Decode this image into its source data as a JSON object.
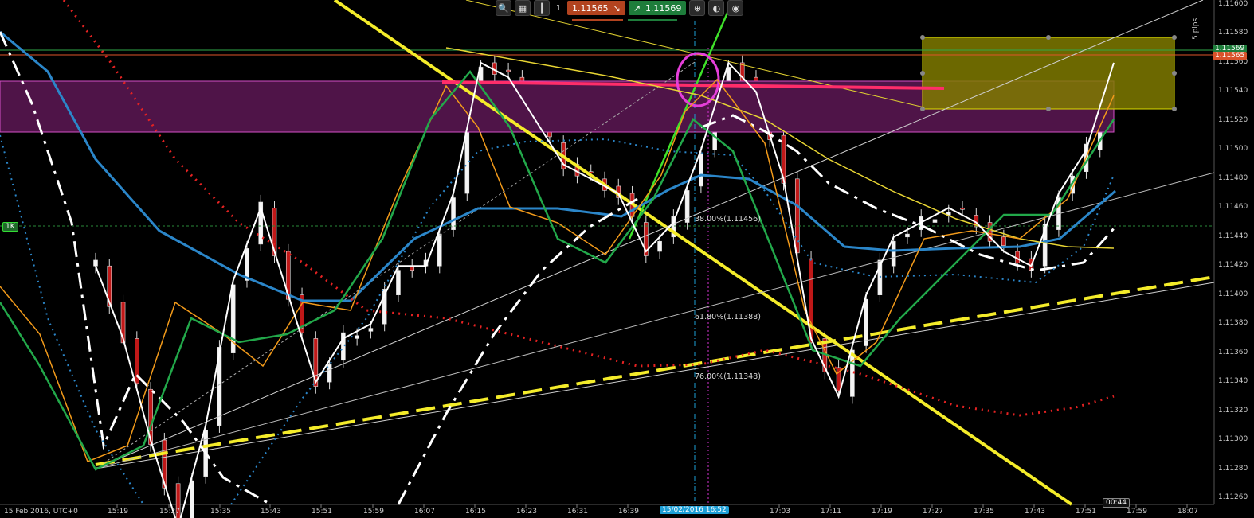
{
  "toolbar": {
    "lot": "1",
    "sell_price": "1.11565",
    "buy_price": "1.11569",
    "icons": [
      "zoom-icon",
      "chart-type-icon",
      "candles-icon",
      "lot-size",
      "trade-icon",
      "settings-icon",
      "timer-icon"
    ]
  },
  "axis": {
    "pips_label": "5 pips",
    "timeframe_label": "15 Feb 2016, UTC+0",
    "crosshair_time": "15/02/2016 16:52",
    "countdown": "00:44",
    "price_tag_1": "1.11569",
    "price_tag_2": "1.11565",
    "order_tag": "1K",
    "price_ticks": [
      "1.11600",
      "1.11580",
      "1.11560",
      "1.11540",
      "1.11520",
      "1.11500",
      "1.11480",
      "1.11460",
      "1.11440",
      "1.11420",
      "1.11400",
      "1.11380",
      "1.11360",
      "1.11340",
      "1.11320",
      "1.11300",
      "1.11280",
      "1.11260"
    ],
    "time_ticks": [
      "15:19",
      "15:27",
      "15:35",
      "15:43",
      "15:51",
      "15:59",
      "16:07",
      "16:15",
      "16:23",
      "16:31",
      "16:39",
      "17:03",
      "17:11",
      "17:19",
      "17:27",
      "17:35",
      "17:43",
      "17:51",
      "17:59",
      "18:07"
    ]
  },
  "fib": {
    "l38": "38.00%(1.11456)",
    "l61": "61.80%(1.11388)",
    "l76": "76.00%(1.11348)"
  },
  "chart_data": {
    "type": "line",
    "symbol_timeframe": "15 Feb 2016, UTC+0",
    "ylim": [
      1.1126,
      1.1161
    ],
    "x_range": [
      "15:19",
      "18:07"
    ],
    "series": [
      {
        "values": [
          [
            0,
            1.1142
          ],
          [
            2,
            1.1137
          ],
          [
            4,
            1.113
          ],
          [
            6,
            1.1124
          ],
          [
            8,
            1.1131
          ],
          [
            10,
            1.1141
          ],
          [
            12,
            1.1146
          ],
          [
            14,
            1.114
          ],
          [
            16,
            1.1134
          ],
          [
            18,
            1.1137
          ],
          [
            20,
            1.1138
          ],
          [
            22,
            1.1142
          ],
          [
            24,
            1.1142
          ],
          [
            26,
            1.1147
          ],
          [
            28,
            1.1156
          ],
          [
            30,
            1.1155
          ],
          [
            32,
            1.1152
          ],
          [
            34,
            1.1149
          ],
          [
            36,
            1.1148
          ],
          [
            38,
            1.1147
          ],
          [
            40,
            1.1143
          ],
          [
            42,
            1.1145
          ],
          [
            44,
            1.115
          ],
          [
            46,
            1.1156
          ],
          [
            48,
            1.1154
          ],
          [
            50,
            1.1148
          ],
          [
            52,
            1.1137
          ],
          [
            54,
            1.1133
          ],
          [
            56,
            1.114
          ],
          [
            58,
            1.1144
          ],
          [
            60,
            1.1145
          ],
          [
            62,
            1.1146
          ],
          [
            64,
            1.1145
          ],
          [
            66,
            1.1143
          ],
          [
            68,
            1.1142
          ],
          [
            70,
            1.1147
          ],
          [
            72,
            1.115
          ],
          [
            74,
            1.1156
          ]
        ]
      }
    ]
  }
}
